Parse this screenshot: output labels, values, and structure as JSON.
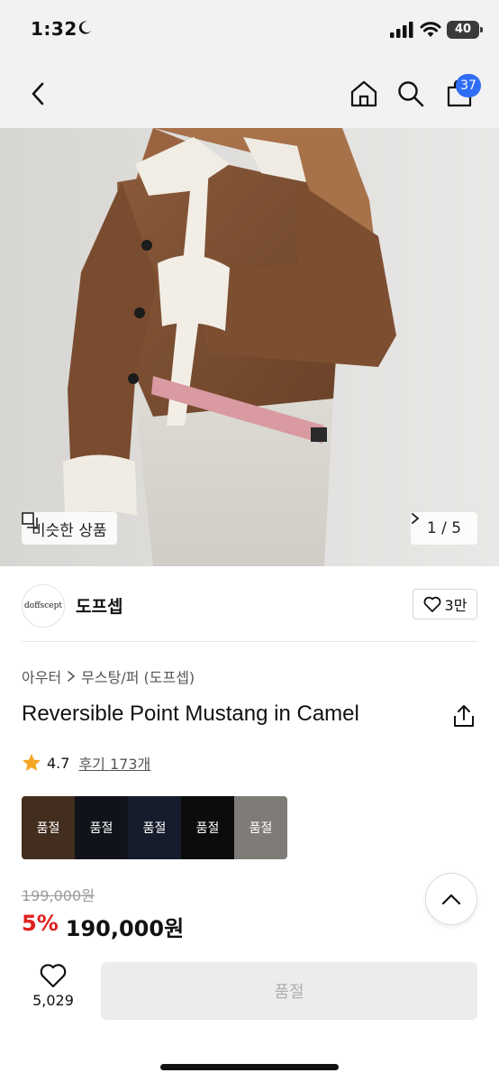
{
  "status_bar": {
    "time": "1:32",
    "battery": "40"
  },
  "nav": {
    "cart_count": "37"
  },
  "hero": {
    "similar_label": "비슷한 상품",
    "page_indicator": "1 / 5"
  },
  "brand": {
    "logo_text": "doffscept",
    "name": "도프셉",
    "like_count": "3만"
  },
  "breadcrumb": {
    "category": "아우터",
    "subcategory": "무스탕/퍼 (도프셉)"
  },
  "product": {
    "title": "Reversible Point Mustang in Camel",
    "rating": "4.7",
    "review_label": "후기 173개"
  },
  "swatches": [
    {
      "label": "품절",
      "color": "#7a5238"
    },
    {
      "label": "품절",
      "color": "#1e2430"
    },
    {
      "label": "품절",
      "color": "#2a3350"
    },
    {
      "label": "품절",
      "color": "#161616"
    },
    {
      "label": "품절",
      "color": "#e8e2da"
    }
  ],
  "price": {
    "original": "199,000원",
    "discount": "5%",
    "sale": "190,000원"
  },
  "bottom_bar": {
    "wish_count": "5,029",
    "buy_label": "품절"
  },
  "colors": {
    "accent_blue": "#2f6df6",
    "discount_red": "#e0201f",
    "star_orange": "#f5a623"
  }
}
